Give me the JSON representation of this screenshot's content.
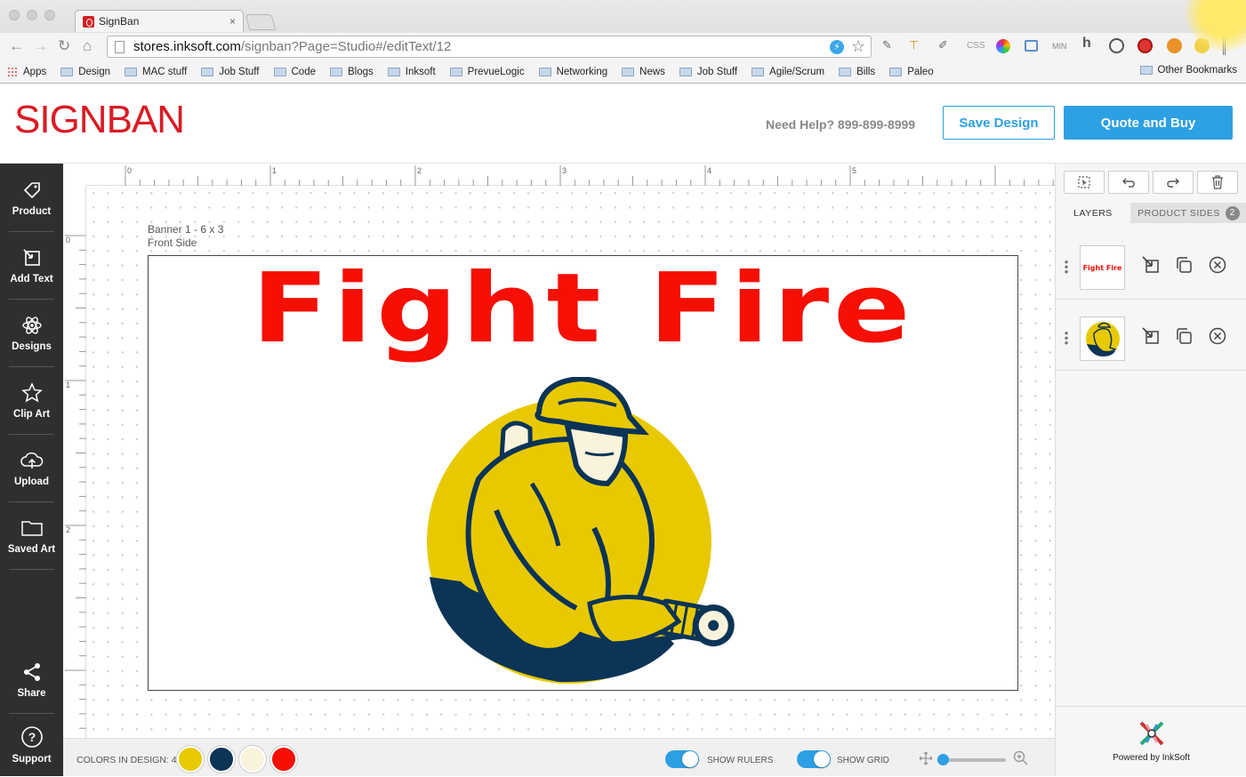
{
  "browser": {
    "tab_title": "SignBan",
    "tab_close": "×",
    "url_host": "stores.inksoft.com",
    "url_path": "/signban?Page=Studio#/editText/12",
    "bookmarks": [
      "Apps",
      "Design",
      "MAC stuff",
      "Job Stuff",
      "Code",
      "Blogs",
      "Inksoft",
      "PrevueLogic",
      "Networking",
      "News",
      "Job Stuff",
      "Agile/Scrum",
      "Bills",
      "Paleo"
    ],
    "other_bookmarks": "Other Bookmarks",
    "ext_css": "CSS",
    "ext_min": "MIN",
    "ext_h": "h"
  },
  "header": {
    "logo": "SIGNBAN",
    "help_text": "Need Help? 899-899-8999",
    "save_label": "Save Design",
    "quote_label": "Quote and Buy"
  },
  "leftnav": {
    "items": [
      {
        "label": "Product",
        "icon": "tag-icon"
      },
      {
        "label": "Add Text",
        "icon": "add-text-icon"
      },
      {
        "label": "Designs",
        "icon": "atom-icon"
      },
      {
        "label": "Clip Art",
        "icon": "star-icon"
      },
      {
        "label": "Upload",
        "icon": "cloud-upload-icon"
      },
      {
        "label": "Saved Art",
        "icon": "folder-icon"
      },
      {
        "label": "Share",
        "icon": "share-icon"
      },
      {
        "label": "Support",
        "icon": "help-icon"
      }
    ]
  },
  "canvas": {
    "ruler_top_labels": [
      "0",
      "1",
      "2",
      "3",
      "4",
      "5"
    ],
    "ruler_left_labels": [
      "0",
      "1",
      "2"
    ],
    "banner_name": "Banner 1 - 6 x 3",
    "banner_side": "Front Side",
    "headline": "Fight Fire"
  },
  "bottombar": {
    "colors_label": "COLORS IN DESIGN: 4",
    "colors": [
      "#e8c900",
      "#0c3457",
      "#faf3dc",
      "#f50f05"
    ],
    "show_rulers_label": "SHOW RULERS",
    "show_rulers": true,
    "show_grid_label": "SHOW GRID",
    "show_grid": true
  },
  "rightpanel": {
    "tabs": {
      "layers": "LAYERS",
      "product_sides": "PRODUCT SIDES",
      "sides_count": "2"
    },
    "layers": [
      {
        "name": "Fight Fire",
        "type": "text"
      },
      {
        "name": "firefighter",
        "type": "image"
      }
    ],
    "powered_by": "Powered by InkSoft"
  }
}
